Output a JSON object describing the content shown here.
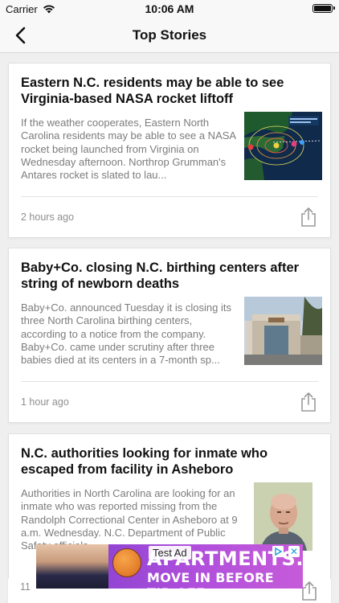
{
  "status_bar": {
    "carrier": "Carrier",
    "time": "10:06 AM"
  },
  "nav": {
    "title": "Top Stories",
    "back_icon": "chevron-left-icon"
  },
  "stories": [
    {
      "headline": "Eastern N.C. residents may be able to see Virginia-based NASA rocket liftoff",
      "summary": "If the weather cooperates, Eastern North Carolina residents may be able to see a NASA rocket being launched from Virginia on Wednesday afternoon. Northrop Grumman's Antares rocket is slated to lau...",
      "time_ago": "2 hours ago"
    },
    {
      "headline": "Baby+Co. closing N.C. birthing centers after string of newborn deaths",
      "summary": "Baby+Co. announced Tuesday it is closing its three North Carolina birthing centers, according to a notice from the company. Baby+Co. came under scrutiny after three babies died at its centers in a 7-month sp...",
      "time_ago": "1 hour ago"
    },
    {
      "headline": "N.C. authorities looking for inmate who escaped from facility in Asheboro",
      "summary": "Authorities in North Carolina are looking for an inmate who was reported missing from the Randolph Correctional Center in Asheboro at 9 a.m. Wednesday. N.C. Department of Public Safety officials ...",
      "time_ago": "11"
    }
  ],
  "ad": {
    "label": "Test Ad",
    "brand": "APARTMENTS.COM",
    "tagline": "MOVE IN BEFORE TIP-OFF.",
    "close_glyph": "✕"
  }
}
